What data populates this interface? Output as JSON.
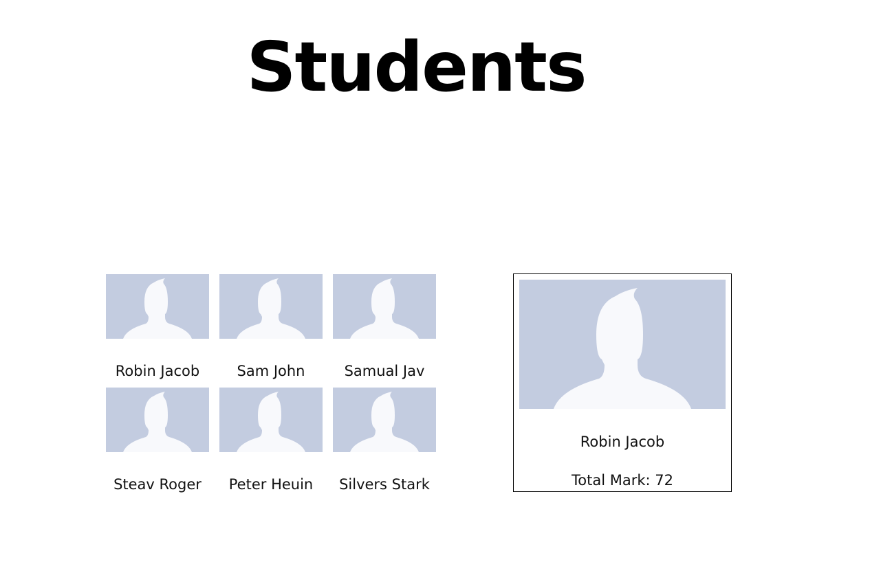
{
  "page": {
    "title": "Students"
  },
  "students": [
    {
      "name": "Robin Jacob"
    },
    {
      "name": "Sam John"
    },
    {
      "name": "Samual Jav"
    },
    {
      "name": "Steav Roger"
    },
    {
      "name": "Peter Heuin"
    },
    {
      "name": "Silvers Stark"
    }
  ],
  "detail": {
    "name": "Robin Jacob",
    "mark_label": "Total Mark:",
    "mark_value": "72"
  },
  "icons": {
    "avatar": "default-avatar-silhouette-icon"
  },
  "colors": {
    "avatar_bg": "#c3cce0",
    "avatar_fg": "#f8f9fc",
    "border": "#000000"
  }
}
